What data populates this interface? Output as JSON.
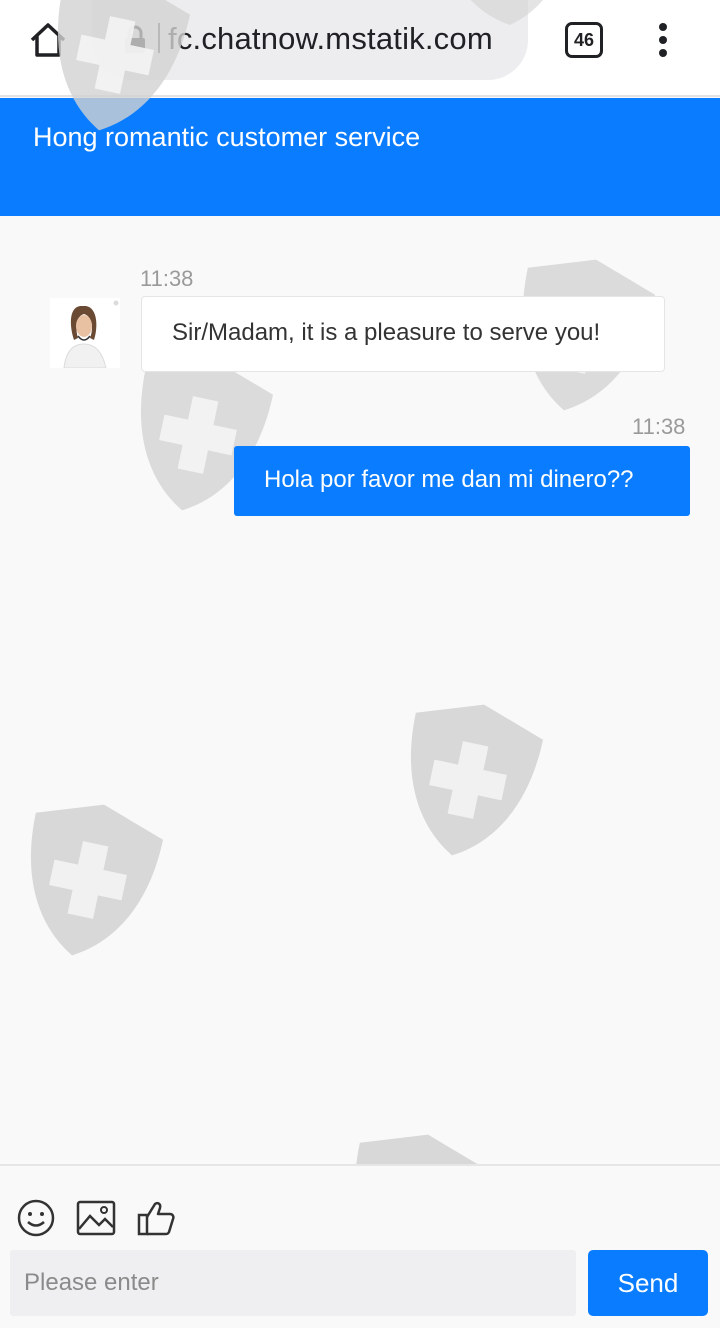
{
  "browser": {
    "url": "fc.chatnow.mstatik.com",
    "tab_count": "46"
  },
  "header": {
    "title": "Hong romantic customer service"
  },
  "messages": [
    {
      "direction": "incoming",
      "time": "11:38",
      "text": "Sir/Madam, it is a pleasure to serve you!"
    },
    {
      "direction": "outgoing",
      "time": "11:38",
      "text": "Hola por favor me dan mi dinero??"
    }
  ],
  "footer": {
    "tools": [
      "emoji-icon",
      "image-icon",
      "thumbs-up-icon"
    ],
    "input_placeholder": "Please enter",
    "input_value": "",
    "send_label": "Send"
  },
  "colors": {
    "accent": "#0a7cff",
    "background": "#f9f9f9",
    "watermark": "#cfcfcf"
  }
}
